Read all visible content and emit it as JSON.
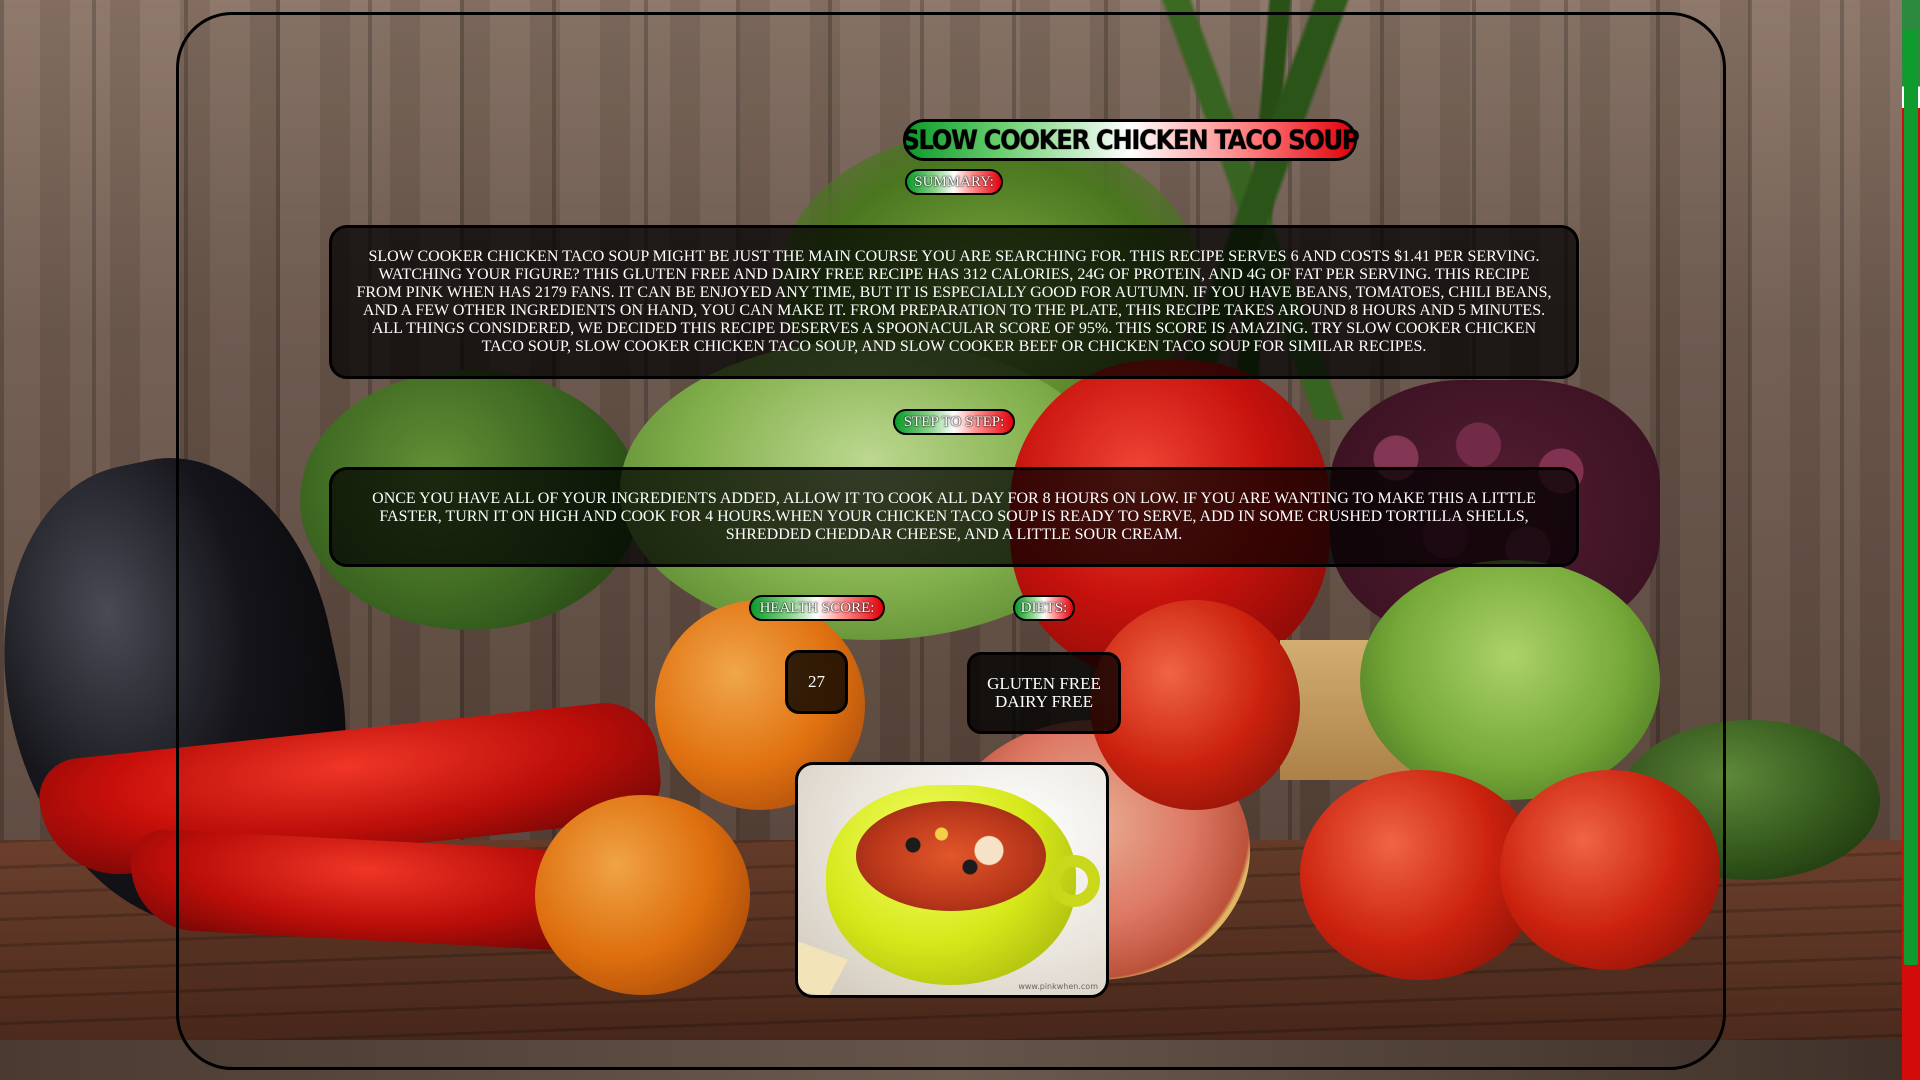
{
  "recipe": {
    "title": "SLOW COOKER CHICKEN TACO SOUP",
    "summary_label": "SUMMARY:",
    "summary_text": "Slow Cooker Chicken Taco Soup might be just the main course you are searching for. This recipe serves 6 and costs $1.41 per serving. Watching your figure? This gluten free and dairy free recipe has 312 calories, 24g of protein, and 4g of fat per serving. This recipe from Pink When has 2179 fans. It can be enjoyed any time, but it is especially good for Autumn. If you have beans, tomatoes, chili beans, and a few other ingredients on hand, you can make it. From preparation to the plate, this recipe takes around 8 hours and 5 minutes. All things considered, we decided this recipe deserves a spoonacular score of 95%. This score is amazing. Try Slow Cooker Chicken Taco Soup, Slow Cooker Chicken Taco Soup, and Slow Cooker Beef or Chicken Taco Soup for similar recipes.",
    "steps_label": "STEP TO STEP:",
    "steps_text": "Once you have all of your ingredients added, allow it to cook all day for 8 hours on low. If you are wanting to make this a little faster, turn it on high and cook for 4 hours.When your chicken taco soup is ready to serve, add in some crushed tortilla shells, shredded cheddar cheese, and a little sour cream.",
    "health_score_label": "HEALTH SCORE:",
    "health_score": "27",
    "diets_label": "DIETS:",
    "diets": [
      "gluten free",
      "dairy free"
    ],
    "image_alt": "Slow Cooker Chicken Taco Soup",
    "image_watermark": "www.pinkwhen.com"
  },
  "colors": {
    "flag_green": "#0b9a2a",
    "flag_white": "#ffffff",
    "flag_red": "#e0000a",
    "scroll_thumb": "#0f9b2e"
  }
}
